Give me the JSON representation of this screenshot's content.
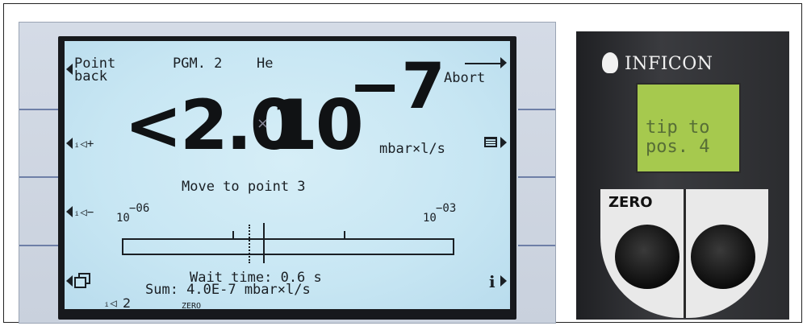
{
  "lcd": {
    "top_left_line1": "Point",
    "top_left_line2": "back",
    "program": "PGM. 2",
    "gas": "He",
    "abort_label": "Abort",
    "volume_up": "ᵢ◁+",
    "volume_down": "ᵢ◁−",
    "reading_prefix": "<2.0",
    "times_sign": "×",
    "base": "10",
    "exponent": "−7",
    "unit": "mbar×l/s",
    "message": "Move to point 3",
    "scale_min_base": "10",
    "scale_min_exp": "−06",
    "scale_max_base": "10",
    "scale_max_exp": "−03",
    "wait_time": "Wait time: 0.6 s",
    "sum": "Sum: 4.0E-7 mbar×l/s",
    "volume_level": "2",
    "zero_label": "ZERO",
    "info_label": "i"
  },
  "handheld": {
    "brand": "INFICON",
    "display_line1": "tip to",
    "display_line2": "pos. 4",
    "zero_button_label": "ZERO"
  }
}
